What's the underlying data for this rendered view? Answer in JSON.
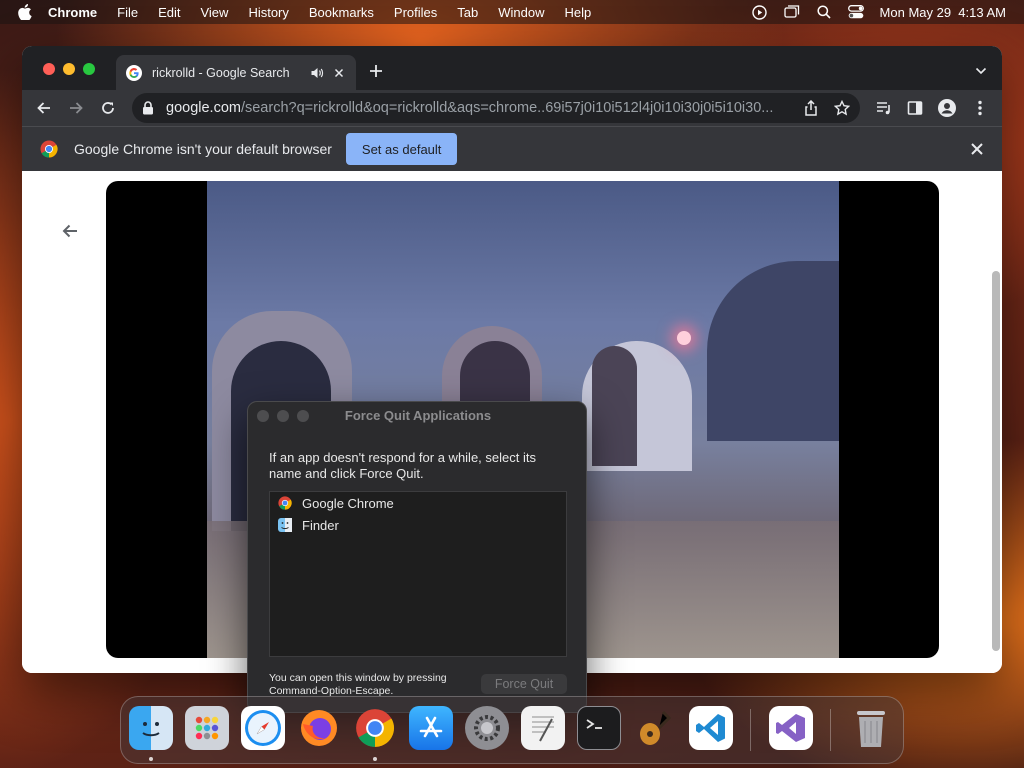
{
  "menubar": {
    "app_name": "Chrome",
    "items": [
      "File",
      "Edit",
      "View",
      "History",
      "Bookmarks",
      "Profiles",
      "Tab",
      "Window",
      "Help"
    ],
    "clock": "Mon May 29  4:13 AM"
  },
  "browser": {
    "tab_title": "rickrolld - Google Search",
    "url_host": "google.com",
    "url_path": "/search?q=rickrolld&oq=rickrolld&aqs=chrome..69i57j0i10i512l4j0i10i30j0i5i10i30...",
    "infobar_text": "Google Chrome isn't your default browser",
    "infobar_button": "Set as default"
  },
  "force_quit": {
    "title": "Force Quit Applications",
    "message": "If an app doesn't respond for a while, select its name and click Force Quit.",
    "apps": [
      "Google Chrome",
      "Finder"
    ],
    "hint": "You can open this window by pressing Command-Option-Escape.",
    "button": "Force Quit"
  },
  "dock": {
    "apps": [
      "finder",
      "launchpad",
      "safari",
      "firefox",
      "chrome",
      "app-store",
      "system-preferences",
      "textedit",
      "terminal",
      "garageband",
      "vscode",
      "visual-studio",
      "trash"
    ]
  },
  "colors": {
    "accent_blue": "#8ab4f8",
    "chrome_dark": "#202124",
    "toolbar": "#35363a"
  }
}
